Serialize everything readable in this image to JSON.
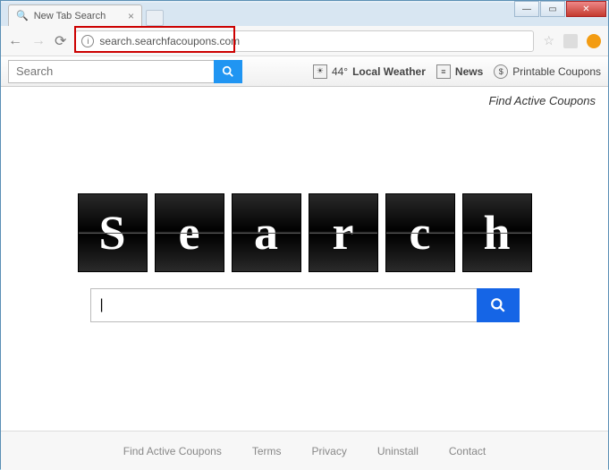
{
  "window": {
    "tab_title": "New Tab Search",
    "url": "search.searchfacoupons.com"
  },
  "toolbar": {
    "search_placeholder": "Search",
    "weather_temp": "44°",
    "weather_label": "Local Weather",
    "news_label": "News",
    "coupons_label": "Printable Coupons"
  },
  "page": {
    "tagline": "Find Active Coupons",
    "logo_letters": [
      "S",
      "e",
      "a",
      "r",
      "c",
      "h"
    ],
    "main_search_value": "|"
  },
  "footer": {
    "links": [
      "Find Active Coupons",
      "Terms",
      "Privacy",
      "Uninstall",
      "Contact"
    ]
  }
}
